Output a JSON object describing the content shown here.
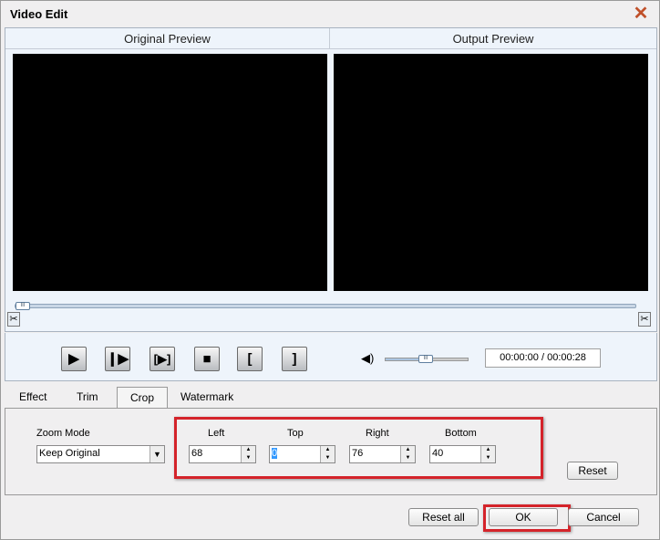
{
  "window": {
    "title": "Video Edit"
  },
  "preview": {
    "original_label": "Original Preview",
    "output_label": "Output Preview"
  },
  "playback": {
    "time": "00:00:00 / 00:00:28",
    "seek_position": 0.01,
    "volume": 0.45,
    "buttons": [
      {
        "name": "play",
        "glyph": "▶"
      },
      {
        "name": "step-forward",
        "glyph": "|▶"
      },
      {
        "name": "play-segment",
        "glyph": "[▶]"
      },
      {
        "name": "stop",
        "glyph": "■"
      },
      {
        "name": "mark-in",
        "glyph": "["
      },
      {
        "name": "mark-out",
        "glyph": "]"
      }
    ]
  },
  "tabs": [
    "Effect",
    "Trim",
    "Crop",
    "Watermark"
  ],
  "active_tab": "Crop",
  "crop": {
    "zoom_mode_label": "Zoom Mode",
    "zoom_mode_value": "Keep Original",
    "left_label": "Left",
    "left": "68",
    "top_label": "Top",
    "top": "0",
    "right_label": "Right",
    "right": "76",
    "bottom_label": "Bottom",
    "bottom": "40",
    "reset": "Reset"
  },
  "footer": {
    "reset_all": "Reset all",
    "ok": "OK",
    "cancel": "Cancel"
  },
  "colors": {
    "highlight": "#d4232a"
  }
}
